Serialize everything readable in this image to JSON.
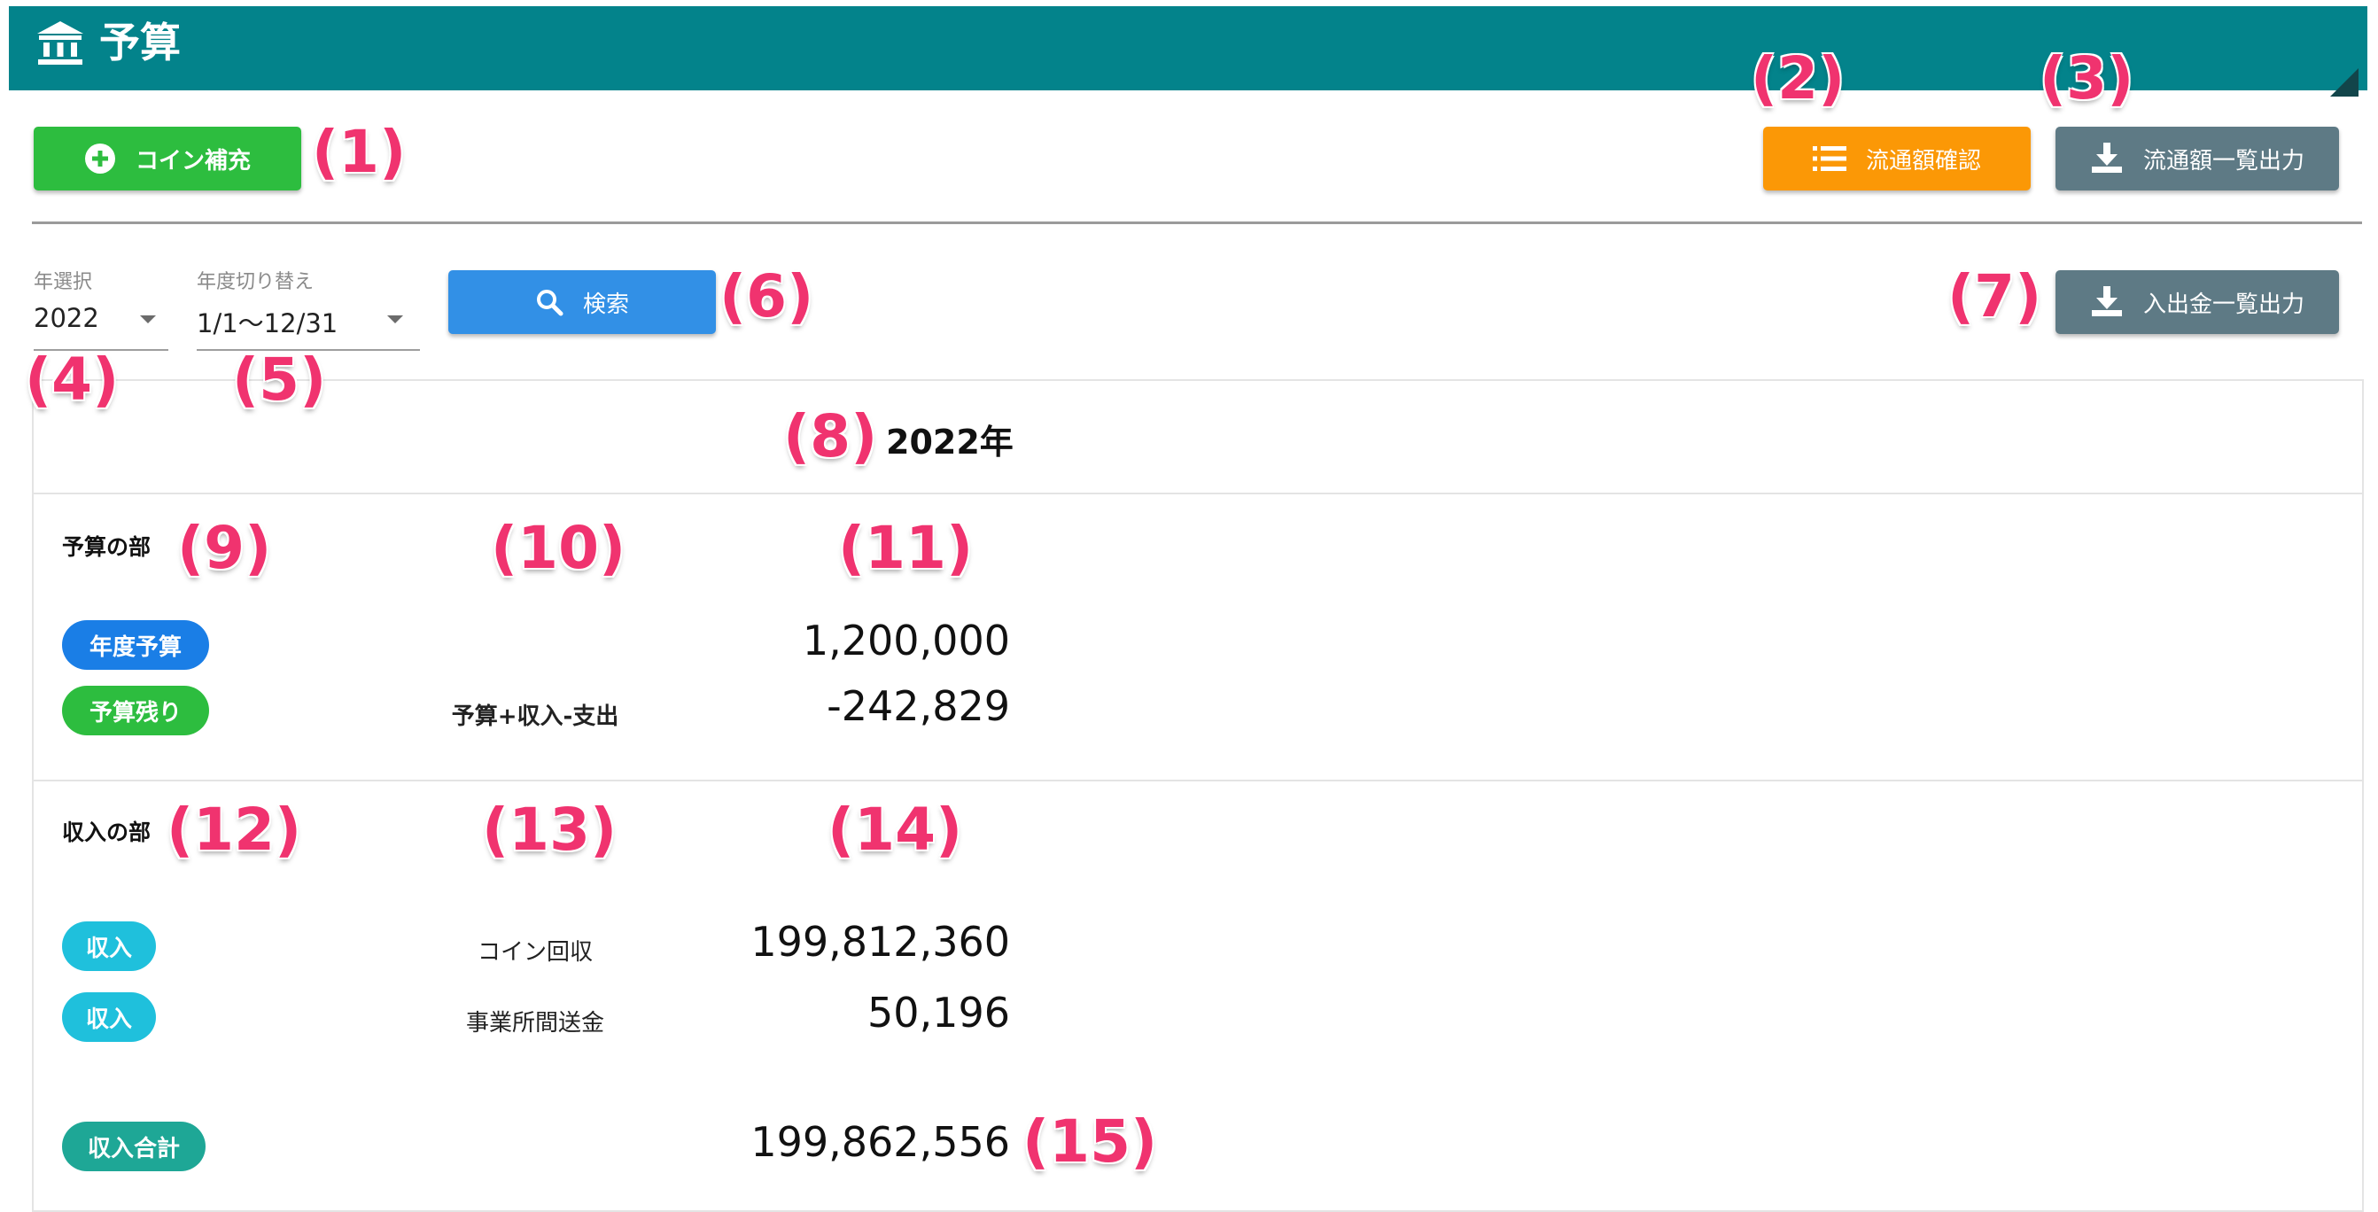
{
  "header": {
    "title": "予算",
    "icon": "bank-icon",
    "bg_color": "#03838b"
  },
  "toolbar": {
    "coin_refill_label": "コイン補充",
    "circulation_check_label": "流通額確認",
    "circulation_export_label": "流通額一覧出力",
    "deposit_export_label": "入出金一覧出力",
    "search_label": "検索"
  },
  "filters": {
    "year": {
      "label": "年選択",
      "value": "2022"
    },
    "period": {
      "label": "年度切り替え",
      "value": "1/1〜12/31"
    }
  },
  "report": {
    "year_title": "2022年",
    "budget_section": {
      "title": "予算の部",
      "rows": [
        {
          "tag": "年度予算",
          "desc": "",
          "amount": "1,200,000"
        },
        {
          "tag": "予算残り",
          "desc": "予算+収入-支出",
          "amount": "-242,829"
        }
      ]
    },
    "income_section": {
      "title": "収入の部",
      "rows": [
        {
          "tag": "収入",
          "desc": "コイン回収",
          "amount": "199,812,360"
        },
        {
          "tag": "収入",
          "desc": "事業所間送金",
          "amount": "50,196"
        }
      ],
      "total": {
        "tag": "収入合計",
        "amount": "199,862,556"
      }
    }
  },
  "annotations": [
    "(1)",
    "(2)",
    "(3)",
    "(4)",
    "(5)",
    "(6)",
    "(7)",
    "(8)",
    "(9)",
    "(10)",
    "(11)",
    "(12)",
    "(13)",
    "(14)",
    "(15)"
  ],
  "colors": {
    "green": "#2dbd3f",
    "orange": "#fb9806",
    "gray": "#5e7a85",
    "blue": "#3290e6",
    "annotation": "#f0336f",
    "pill_blue": "#1a7ee6",
    "pill_cyan": "#1fc0dc",
    "pill_teal": "#1ea796"
  }
}
